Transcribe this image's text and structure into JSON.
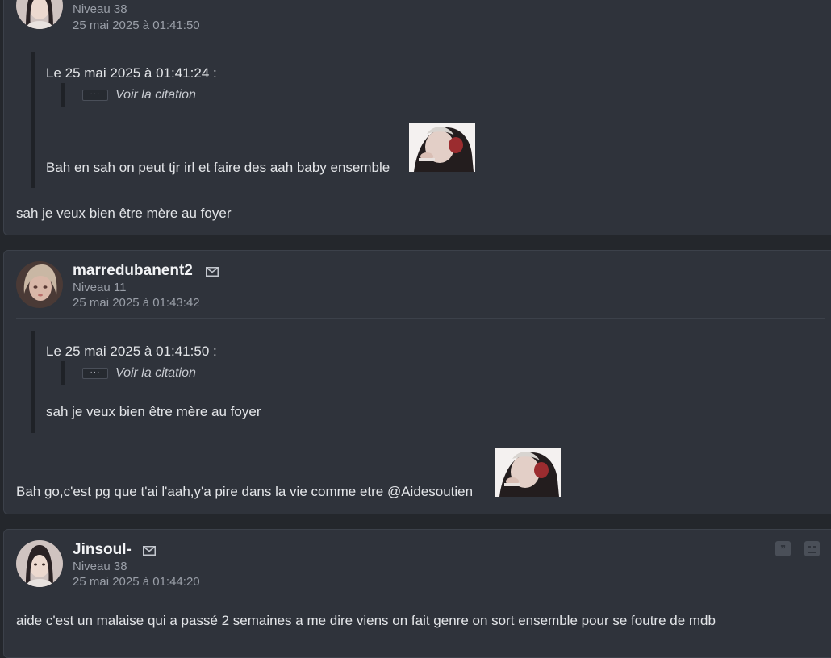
{
  "posts": [
    {
      "level": "Niveau 38",
      "date": "25 mai 2025 à 01:41:50",
      "quote": {
        "header": "Le 25 mai 2025 à 01:41:24 :",
        "dots": "···",
        "view_label": "Voir la citation",
        "text": "Bah en sah on peut tjr irl et faire des aah baby ensemble"
      },
      "message": "sah je veux bien être mère au foyer"
    },
    {
      "username": "marredubanent2",
      "level": "Niveau 11",
      "date": "25 mai 2025 à 01:43:42",
      "quote": {
        "header": "Le 25 mai 2025 à 01:41:50 :",
        "dots": "···",
        "view_label": "Voir la citation",
        "text": "sah je veux bien être mère au foyer"
      },
      "message": "Bah go,c'est pg que t'ai l'aah,y'a pire dans la vie comme etre @Aidesoutien"
    },
    {
      "username": "Jinsoul-",
      "level": "Niveau 38",
      "date": "25 mai 2025 à 01:44:20",
      "message": "aide c'est un malaise qui a passé 2 semaines a me dire viens on fait genre on sort ensemble pour se foutre de mdb",
      "actions": [
        "quote-icon",
        "sad-face-icon"
      ]
    }
  ]
}
